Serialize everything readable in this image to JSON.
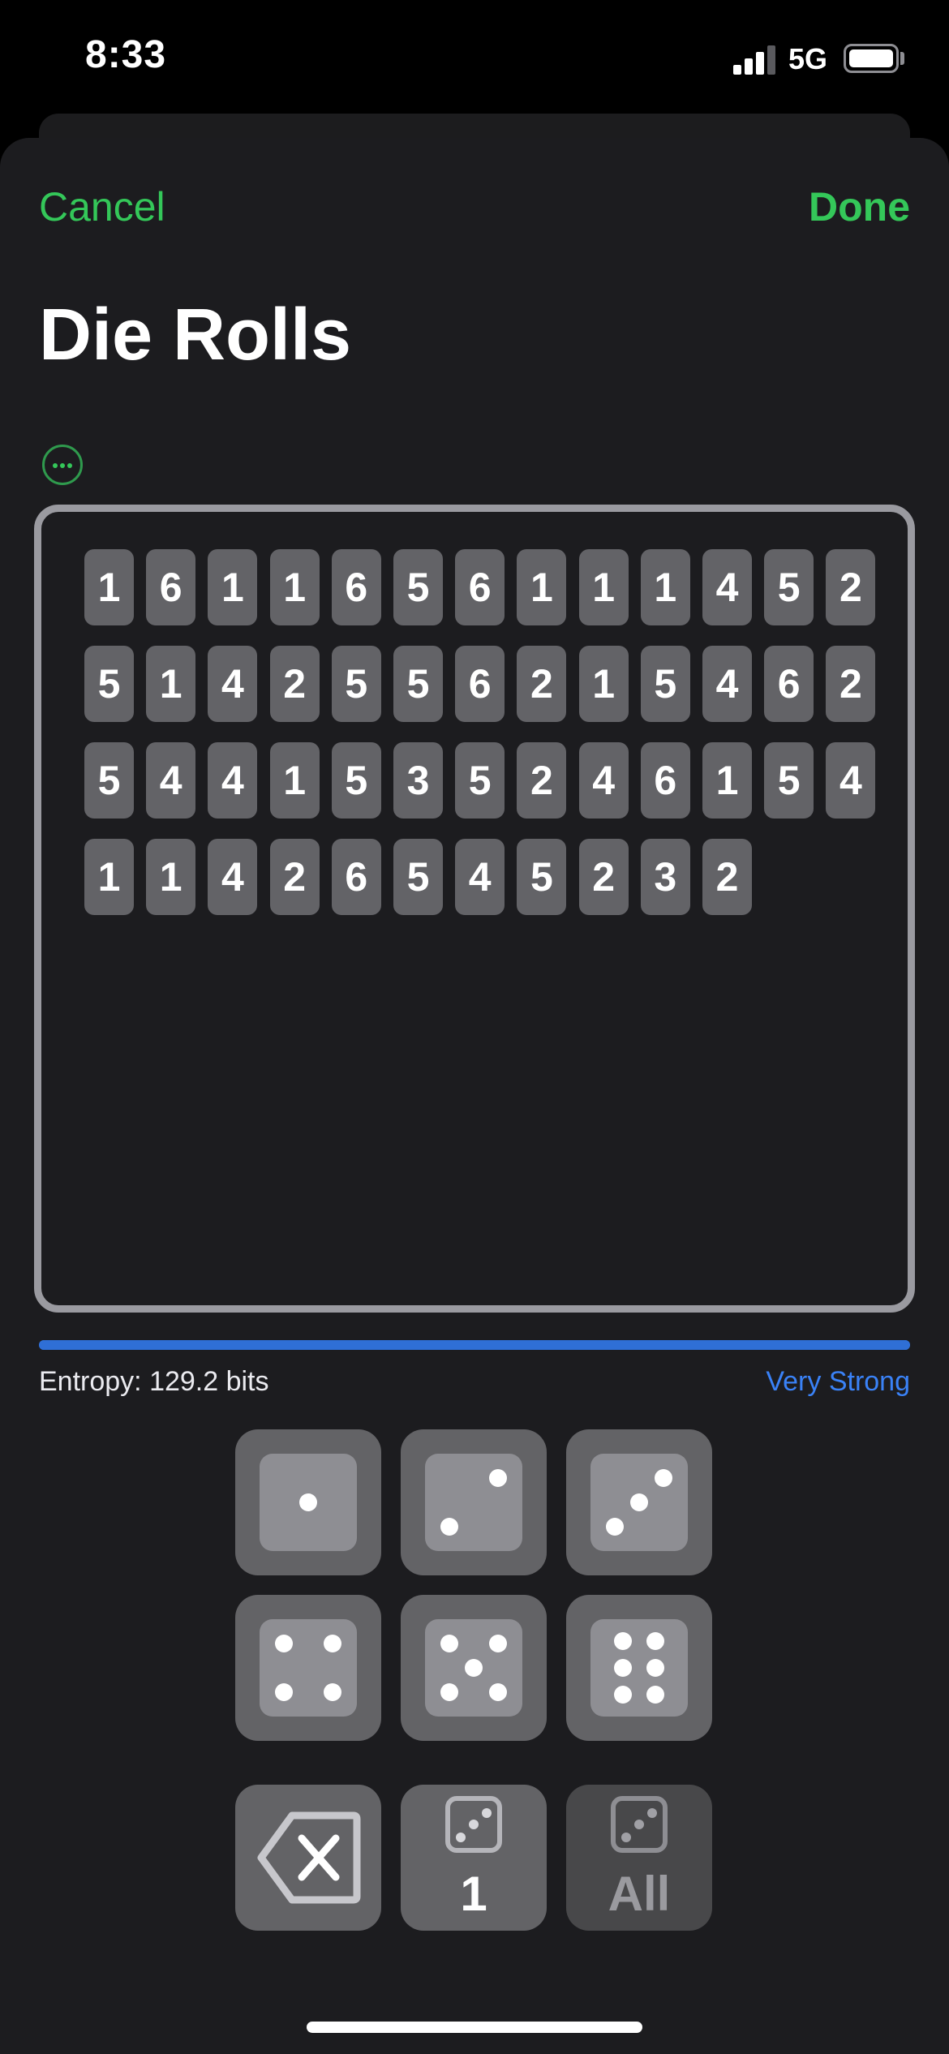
{
  "status_bar": {
    "time": "8:33",
    "network": "5G"
  },
  "nav": {
    "cancel_label": "Cancel",
    "done_label": "Done"
  },
  "title": "Die Rolls",
  "rolls": [
    [
      1,
      6,
      1,
      1,
      6,
      5,
      6,
      1,
      1,
      1,
      4,
      5,
      2
    ],
    [
      5,
      1,
      4,
      2,
      5,
      5,
      6,
      2,
      1,
      5,
      4,
      6,
      2
    ],
    [
      5,
      4,
      4,
      1,
      5,
      3,
      5,
      2,
      4,
      6,
      1,
      5,
      4
    ],
    [
      1,
      1,
      4,
      2,
      6,
      5,
      4,
      5,
      2,
      3,
      2
    ]
  ],
  "entropy": {
    "label": "Entropy: 129.2 bits",
    "strength": "Very Strong",
    "progress": 1.0,
    "color": "#2f6fd6"
  },
  "die_buttons": [
    1,
    2,
    3,
    4,
    5,
    6
  ],
  "controls": {
    "delete_icon": "delete-backward-icon",
    "roll_one_label": "1",
    "roll_all_label": "All"
  },
  "colors": {
    "accent": "#34c759",
    "strength": "#3a82f7",
    "background": "#1c1c1f"
  }
}
